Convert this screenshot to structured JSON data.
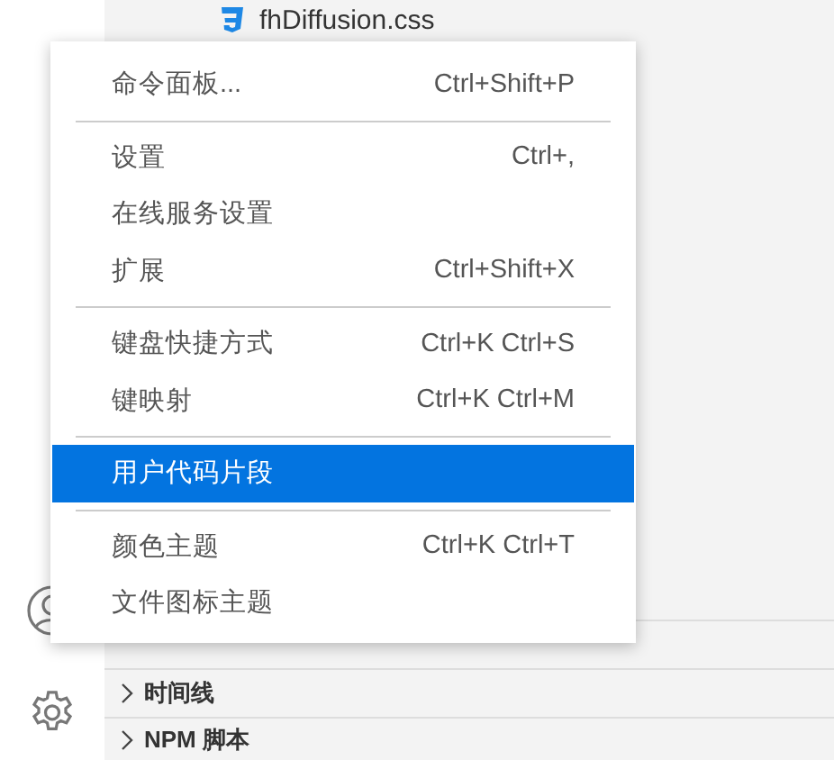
{
  "explorer": {
    "file": {
      "name": "fhDiffusion.css"
    }
  },
  "menu": {
    "groups": [
      [
        {
          "label": "命令面板...",
          "shortcut": "Ctrl+Shift+P",
          "selected": false
        }
      ],
      [
        {
          "label": "设置",
          "shortcut": "Ctrl+,",
          "selected": false
        },
        {
          "label": "在线服务设置",
          "selected": false
        },
        {
          "label": "扩展",
          "shortcut": "Ctrl+Shift+X",
          "selected": false
        }
      ],
      [
        {
          "label": "键盘快捷方式",
          "shortcut": "Ctrl+K Ctrl+S",
          "selected": false
        },
        {
          "label": "键映射",
          "shortcut": "Ctrl+K Ctrl+M",
          "selected": false
        }
      ],
      [
        {
          "label": "用户代码片段",
          "selected": true
        }
      ],
      [
        {
          "label": "颜色主题",
          "shortcut": "Ctrl+K Ctrl+T",
          "selected": false
        },
        {
          "label": "文件图标主题",
          "selected": false
        }
      ]
    ]
  },
  "sections": [
    {
      "label": "时间线"
    },
    {
      "label": "NPM 脚本"
    }
  ]
}
